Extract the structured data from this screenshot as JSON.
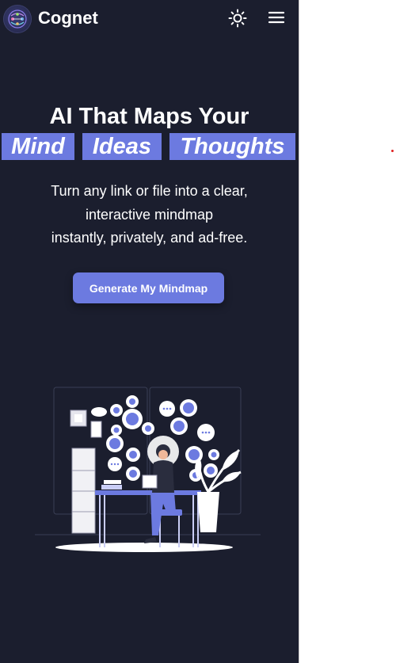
{
  "header": {
    "brand": "Cognet",
    "logo_icon": "brain-network-logo",
    "theme_icon": "sun-icon",
    "menu_icon": "hamburger-menu-icon"
  },
  "hero": {
    "title": "AI That Maps Your",
    "highlights": [
      "Mind",
      "Ideas",
      "Thoughts"
    ],
    "subtitle_lines": [
      "Turn any link or file into a clear,",
      "interactive mindmap",
      "instantly, privately, and ad-free."
    ],
    "cta_label": "Generate My Mindmap"
  },
  "colors": {
    "panel_bg": "#1b1e2e",
    "accent": "#6c7ae0",
    "text": "#ffffff"
  }
}
